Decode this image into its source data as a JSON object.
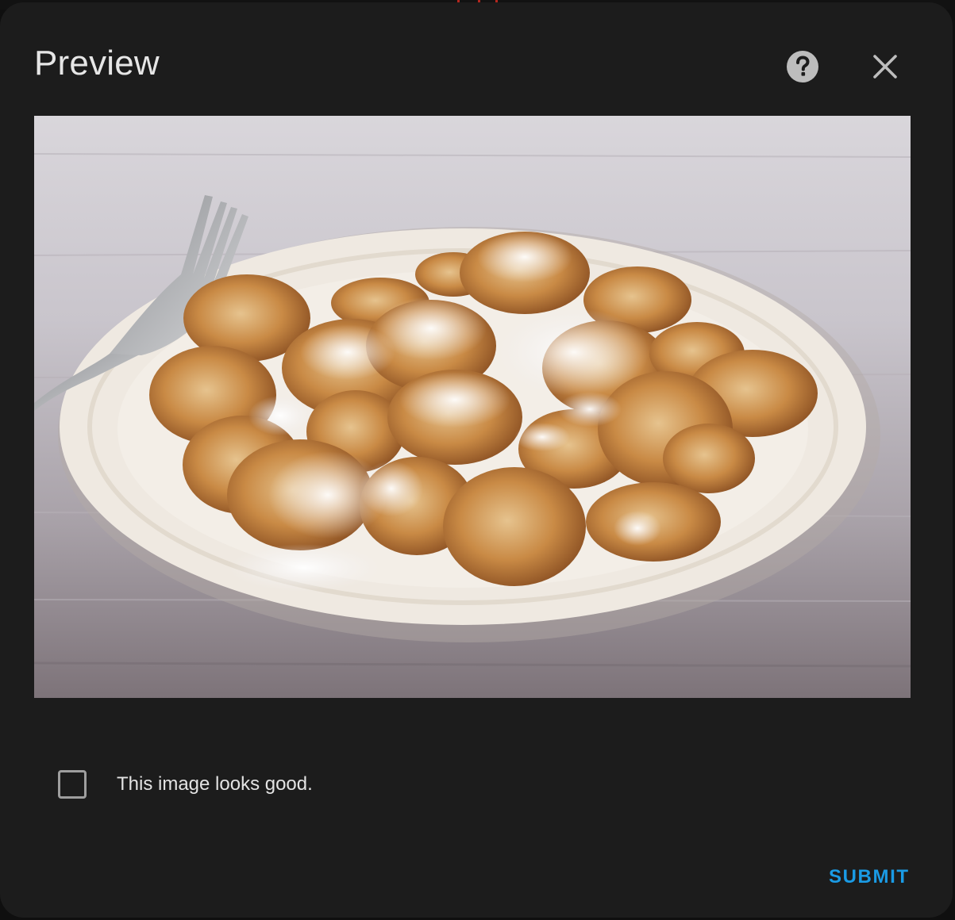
{
  "dialog": {
    "title": "Preview",
    "help_icon": "help-circle-icon",
    "close_icon": "close-icon"
  },
  "image": {
    "alt": "Plate of mini pancakes dusted with powdered sugar beside a fork"
  },
  "confirm": {
    "label": "This image looks good.",
    "checked": false
  },
  "actions": {
    "submit_label": "SUBMIT"
  },
  "colors": {
    "dialog_bg": "#1c1c1c",
    "accent": "#1a9be5",
    "text": "#e6e6e6"
  }
}
